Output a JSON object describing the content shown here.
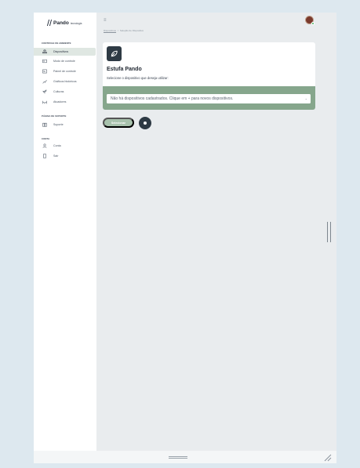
{
  "app": {
    "brand": "Pando",
    "brand_sub": "tecnologia"
  },
  "sidebar": {
    "sections": [
      {
        "title": "CONTROLE DE AMBIENTE"
      },
      {
        "title": "PÁGINA DE SUPORTE"
      },
      {
        "title": "CONTA"
      }
    ],
    "items": [
      {
        "label": "Dispositivos",
        "icon": "router-icon",
        "active": true
      },
      {
        "label": "Modo de controle",
        "icon": "settings-box-icon"
      },
      {
        "label": "Painel de controle",
        "icon": "panel-icon"
      },
      {
        "label": "Gráficos históricos",
        "icon": "chart-icon"
      },
      {
        "label": "Culturas",
        "icon": "plant-icon"
      },
      {
        "label": "Atuadores",
        "icon": "actuator-icon"
      },
      {
        "label": "Suporte",
        "icon": "book-icon"
      },
      {
        "label": "Conta",
        "icon": "user-icon"
      },
      {
        "label": "Sair",
        "icon": "logout-icon"
      }
    ]
  },
  "header": {
    "menu_icon": "≡",
    "breadcrumb": {
      "link": "Dispositivos",
      "separator": "/",
      "current": "Seleção de Dispositivo"
    }
  },
  "card": {
    "title": "Estufa Pando",
    "subtitle": "Selecione o dispositivo que deseja utilizar:",
    "select_value": "Não há dispositivos cadastrados. Clique em + para novos dispositivos."
  },
  "actions": {
    "select_button": "Selecionar"
  },
  "colors": {
    "accent_green": "#86a68c",
    "dark": "#2e3a44",
    "active_bg": "#dfe7e2"
  }
}
